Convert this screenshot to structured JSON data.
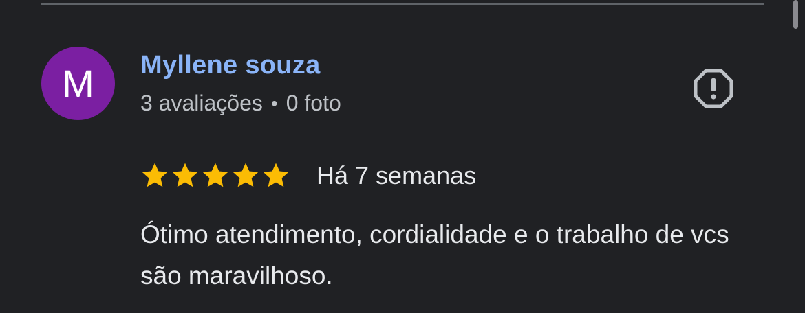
{
  "review": {
    "avatar_letter": "M",
    "avatar_color": "#7b1fa2",
    "author_name": "Myllene souza",
    "reviews_count": "3 avaliações",
    "separator": "•",
    "photos_count": "0 foto",
    "rating": 5,
    "rating_max": 5,
    "date": "Há 7 semanas",
    "text": "Ótimo atendimento, cordialidade e o trabalho de vcs são maravilhoso.",
    "report_icon": "report-flag-icon",
    "star_icon": "star-icon",
    "star_color": "#fbbc04",
    "name_color": "#8ab4f8"
  }
}
